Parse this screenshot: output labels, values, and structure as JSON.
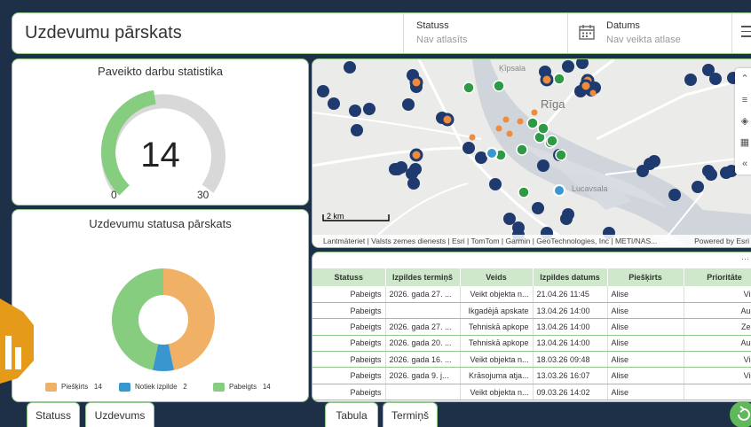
{
  "header": {
    "title": "Uzdevumu pārskats",
    "status_label": "Statuss",
    "status_value": "Nav atlasīts",
    "date_label": "Datums",
    "date_value": "Nav veikta atlase"
  },
  "gauge": {
    "title": "Paveikto darbu statistika",
    "value": "14",
    "min": "0",
    "max": "30",
    "fraction": 0.4667
  },
  "donut": {
    "title": "Uzdevumu statusa pārskats",
    "legend": [
      {
        "label": "Piešķirts",
        "value": "14",
        "color": "#f0b065"
      },
      {
        "label": "Notiek izpilde",
        "value": "2",
        "color": "#3a96cf"
      },
      {
        "label": "Pabeigts",
        "value": "14",
        "color": "#86cd80"
      }
    ]
  },
  "map": {
    "labels": {
      "kipsala": "Ķīpsala",
      "riga": "Rīga",
      "lucavsala": "Lucavsala"
    },
    "scale": "2 km",
    "attribution": "Lantmäteriet | Valsts zemes dienests | Esri | TomTom | Garmin | GeoTechnologies, Inc | METI/NAS...",
    "powered": "Powered by Esri"
  },
  "table": {
    "headers": [
      "Statuss",
      "Izpildes termiņš",
      "Veids",
      "Izpildes datums",
      "Piešķirts",
      "Prioritāte"
    ],
    "rows": [
      [
        "Pabeigts",
        "2026. gada 27. ...",
        "Veikt objekta n...",
        "21.04.26 11:45",
        "Alise",
        "Vidēj"
      ],
      [
        "Pabeigts",
        "",
        "Ikgadējā apskate",
        "13.04.26 14:00",
        "Alise",
        "Augst"
      ],
      [
        "Pabeigts",
        "2026. gada 27. ...",
        "Tehniskā apkope",
        "13.04.26 14:00",
        "Alise",
        "Zems"
      ],
      [
        "Pabeigts",
        "2026. gada 20. ...",
        "Tehniskā apkope",
        "13.04.26 14:00",
        "Alise",
        "Augst"
      ],
      [
        "Pabeigts",
        "2026. gada 16. ...",
        "Veikt objekta n...",
        "18.03.26 09:48",
        "Alise",
        "Vidēj"
      ],
      [
        "Pabeigts",
        "2026. gada 9. j...",
        "Krāsojuma atja...",
        "13.03.26 16:07",
        "Alise",
        "Vidēj"
      ],
      [
        "Pabeigts",
        "",
        "Veikt objekta n...",
        "09.03.26 14:02",
        "Alise",
        ""
      ]
    ]
  },
  "tabs": {
    "statuss": "Statuss",
    "uzdevums": "Uzdevums",
    "tabula": "Tabula",
    "termins": "Termiņš"
  },
  "colors": {
    "accent": "#8fc98b",
    "orange": "#f0b065",
    "blue": "#3a96cf",
    "green": "#86cd80",
    "navy": "#1f3a6e"
  }
}
